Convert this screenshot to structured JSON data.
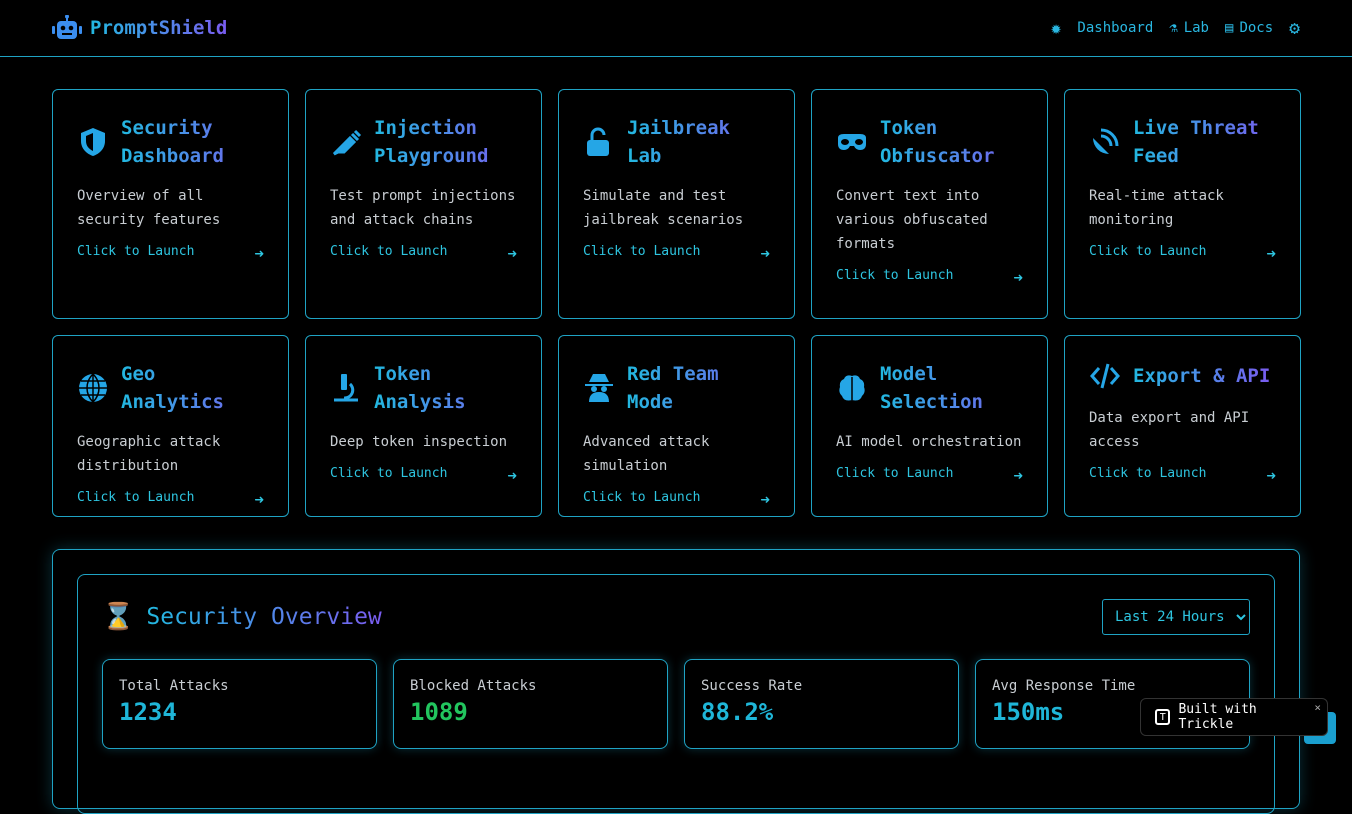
{
  "header": {
    "brand": "PromptShield",
    "nav": [
      {
        "label": "Dashboard",
        "icon": "gear-icon"
      },
      {
        "label": "Lab",
        "icon": "flask-icon"
      },
      {
        "label": "Docs",
        "icon": "book-icon"
      }
    ]
  },
  "cards": [
    {
      "title": "Security Dashboard",
      "desc": "Overview of all security features",
      "launch": "Click to Launch",
      "icon": "shield-icon"
    },
    {
      "title": "Injection Playground",
      "desc": "Test prompt injections and attack chains",
      "launch": "Click to Launch",
      "icon": "syringe-icon"
    },
    {
      "title": "Jailbreak Lab",
      "desc": "Simulate and test jailbreak scenarios",
      "launch": "Click to Launch",
      "icon": "unlock-icon"
    },
    {
      "title": "Token Obfuscator",
      "desc": "Convert text into various obfuscated formats",
      "launch": "Click to Launch",
      "icon": "mask-icon"
    },
    {
      "title": "Live Threat Feed",
      "desc": "Real-time attack monitoring",
      "launch": "Click to Launch",
      "icon": "satellite-icon"
    },
    {
      "title": "Geo Analytics",
      "desc": "Geographic attack distribution",
      "launch": "Click to Launch",
      "icon": "globe-icon"
    },
    {
      "title": "Token Analysis",
      "desc": "Deep token inspection",
      "launch": "Click to Launch",
      "icon": "microscope-icon"
    },
    {
      "title": "Red Team Mode",
      "desc": "Advanced attack simulation",
      "launch": "Click to Launch",
      "icon": "spy-icon"
    },
    {
      "title": "Model Selection",
      "desc": "AI model orchestration",
      "launch": "Click to Launch",
      "icon": "brain-icon"
    },
    {
      "title": "Export & API",
      "desc": "Data export and API access",
      "launch": "Click to Launch",
      "icon": "code-icon"
    }
  ],
  "overview": {
    "title": "Security Overview",
    "range": "Last 24 Hours",
    "stats": [
      {
        "label": "Total Attacks",
        "value": "1234",
        "color": "#1fb6d8"
      },
      {
        "label": "Blocked Attacks",
        "value": "1089",
        "color": "#22c55e"
      },
      {
        "label": "Success Rate",
        "value": "88.2%",
        "color": "#1fb6d8"
      },
      {
        "label": "Avg Response Time",
        "value": "150ms",
        "color": "#1fb6d8"
      }
    ]
  },
  "badge": {
    "label": "Built with Trickle",
    "close": "×"
  }
}
